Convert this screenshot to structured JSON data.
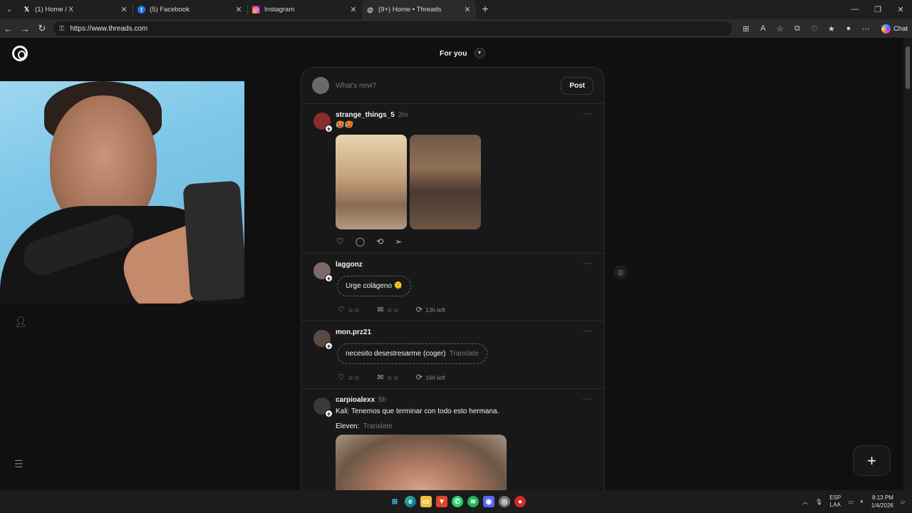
{
  "browser": {
    "tabs": [
      {
        "title": "(1) Home / X",
        "icon": "x-logo-icon",
        "active": false
      },
      {
        "title": "(5) Facebook",
        "icon": "facebook-icon",
        "active": false
      },
      {
        "title": "Instagram",
        "icon": "instagram-icon",
        "active": false
      },
      {
        "title": "(9+) Home • Threads",
        "icon": "threads-icon",
        "active": true
      }
    ],
    "url": "https://www.threads.com",
    "chat_label": "Chat"
  },
  "header": {
    "feed_title": "For you"
  },
  "composer": {
    "placeholder": "What's new?",
    "post_label": "Post"
  },
  "posts": [
    {
      "username": "strange_things_5",
      "time": "2m",
      "body": "🥵🥵"
    },
    {
      "username": "laggonz",
      "time": "",
      "pill": "Urge colágeno 🫠",
      "translate": "",
      "time_left": "13h left"
    },
    {
      "username": "mon.prz21",
      "time": "",
      "pill": "necesito desestresarme (coger)",
      "translate": "Translate",
      "time_left": "16h left"
    },
    {
      "username": "carpioalexx",
      "time": "5h",
      "line1": "Kali: Tenemos que terminar con todo esto hermana.",
      "line2": "Eleven:",
      "translate": "Translate"
    }
  ],
  "taskbar": {
    "language": "ESP",
    "layout": "LAA",
    "time": "8:13 PM",
    "date": "1/4/2026"
  },
  "colors": {
    "background": "#101010",
    "card": "#181818",
    "border": "#2d2d2d",
    "text": "#f3f5f7",
    "muted": "#777777"
  }
}
